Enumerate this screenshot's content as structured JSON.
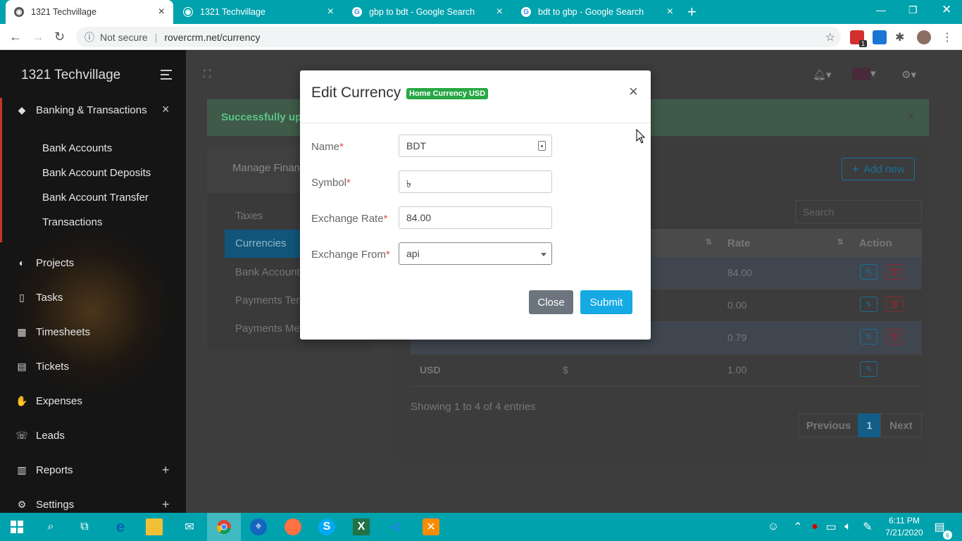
{
  "browser": {
    "tabs": [
      {
        "title": "1321 Techvillage",
        "active": true
      },
      {
        "title": "1321 Techvillage",
        "active": false
      },
      {
        "title": "gbp to bdt - Google Search",
        "active": false
      },
      {
        "title": "bdt to gbp - Google Search",
        "active": false
      }
    ],
    "security": "Not secure",
    "url": "rovercrm.net/currency",
    "extension_badge": "1"
  },
  "sidebar": {
    "brand": "1321 Techvillage",
    "group": {
      "label": "Banking & Transactions",
      "icon": "piggy-bank-icon"
    },
    "sub_items": [
      "Bank Accounts",
      "Bank Account Deposits",
      "Bank Account Transfer",
      "Transactions"
    ],
    "items": [
      {
        "label": "Projects",
        "icon": "projects-icon"
      },
      {
        "label": "Tasks",
        "icon": "clipboard-icon"
      },
      {
        "label": "Timesheets",
        "icon": "calendar-icon"
      },
      {
        "label": "Tickets",
        "icon": "ticket-icon"
      },
      {
        "label": "Expenses",
        "icon": "hand-money-icon"
      },
      {
        "label": "Leads",
        "icon": "phone-icon"
      },
      {
        "label": "Reports",
        "icon": "bar-chart-icon"
      },
      {
        "label": "Settings",
        "icon": "gear-icon"
      }
    ]
  },
  "main": {
    "alert_text": "Successfully upd",
    "card_title": "Manage Financ",
    "nav": [
      "Taxes",
      "Currencies",
      "Bank Account",
      "Payments Terr",
      "Payments Met"
    ],
    "add_new": "Add new",
    "search_placeholder": "Search",
    "table": {
      "headers": [
        "Rate",
        "Action"
      ],
      "rows": [
        {
          "code": "",
          "symbol": "",
          "rate": "84.00"
        },
        {
          "code": "",
          "symbol": "",
          "rate": "0.00"
        },
        {
          "code": "",
          "symbol": "",
          "rate": "0.79"
        },
        {
          "code": "USD",
          "symbol": "$",
          "rate": "1.00"
        }
      ]
    },
    "info": "Showing 1 to 4 of 4 entries",
    "pager": {
      "prev": "Previous",
      "current": "1",
      "next": "Next"
    }
  },
  "modal": {
    "title": "Edit Currency",
    "badge": "Home Currency  USD",
    "close_x": "×",
    "fields": {
      "name_label": "Name",
      "name_value": "BDT",
      "symbol_label": "Symbol",
      "symbol_value": "৳",
      "rate_label": "Exchange Rate",
      "rate_value": "84.00",
      "from_label": "Exchange From",
      "from_value": "api",
      "required_mark": "*"
    },
    "close_button": "Close",
    "submit_button": "Submit"
  },
  "taskbar": {
    "time": "6:11 PM",
    "date": "7/21/2020",
    "notification_count": "6"
  },
  "colors": {
    "tabbar": "#00a2ad",
    "submit": "#15aae3",
    "close": "#6c757d",
    "badge": "#28a745",
    "required": "#d9534f"
  }
}
